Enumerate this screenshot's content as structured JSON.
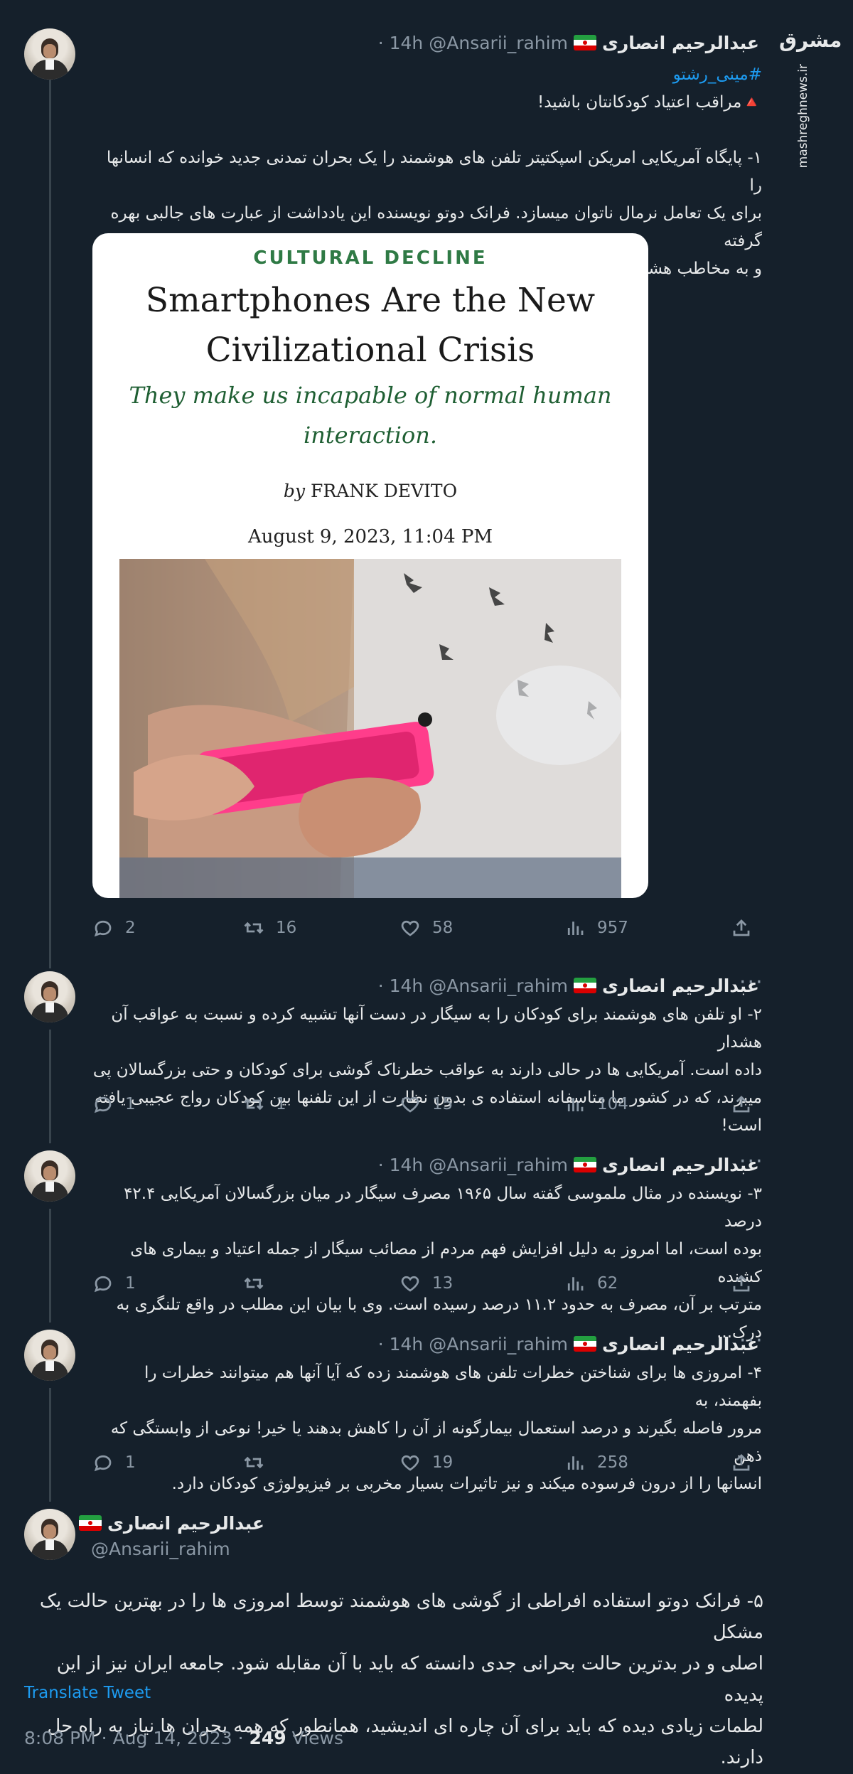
{
  "watermark": {
    "logo": "مشرق",
    "url": "mashreghnews.ir"
  },
  "author": {
    "name": "عبدالرحیم انصاری",
    "handle": "@Ansarii_rahim"
  },
  "tweets": [
    {
      "time": "· 14h",
      "hashtag": "#مینی_رشتو",
      "warning": "🔺مراقب اعتیاد کودکانتان باشید!",
      "text": "۱- پایگاه آمریکایی امریکن اسپکتیتر تلفن های هوشمند را یک بحران تمدنی جدید خوانده که انسانها را\nبرای یک تعامل نرمال ناتوان میسازد. فرانک دوتو نویسنده این یادداشت از عبارت های جالبی بهره گرفته\nو به مخاطب هشدارهای مهمی داده است.",
      "card": {
        "kicker": "CULTURAL DECLINE",
        "headline_1": "Smartphones Are the New",
        "headline_2": "Civilizational Crisis",
        "sub_1": "They make us incapable of normal human",
        "sub_2": "interaction.",
        "by": "by",
        "author": "FRANK DEVITO",
        "date": "August 9, 2023, 11:04 PM"
      },
      "stats": {
        "replies": "2",
        "retweets": "16",
        "likes": "58",
        "views": "957"
      }
    },
    {
      "time": "· 14h",
      "text": "۲- او تلفن های هوشمند برای کودکان را به سیگار در دست آنها تشبیه کرده و نسبت به عواقب آن هشدار\nداده است. آمریکایی ها در حالی دارند به عواقب خطرناک گوشی برای کودکان و حتی بزرگسالان پی\nمیبرند، که در کشور ما متاسفانه استفاده ی بدون نظارت از این تلفنها بین کودکان رواج عجیبی یافته است!",
      "stats": {
        "replies": "1",
        "retweets": "1",
        "likes": "15",
        "views": "104"
      }
    },
    {
      "time": "· 14h",
      "text": "۳- نویسنده در مثال ملموسی گفته سال ۱۹۶۵ مصرف سیگار در میان بزرگسالان آمریکایی ۴۲.۴ درصد\nبوده است، اما امروز به دلیل افزایش فهم مردم از مصائب سیگار از جمله اعتیاد و بیماری های کشنده\nمترتب بر آن، مصرف به حدود ۱۱.۲ درصد رسیده است. وی با بیان این مطلب در واقع تلنگری به درک...",
      "stats": {
        "replies": "1",
        "retweets": "",
        "likes": "13",
        "views": "62"
      }
    },
    {
      "time": "· 14h",
      "text": "۴- امروزی ها برای شناختن خطرات تلفن های هوشمند زده که آیا آنها هم میتوانند خطرات را بفهمند، به\nمرور فاصله بگیرند و درصد استعمال بیمارگونه از آن را کاهش بدهند یا خیر! نوعی از وابستگی که ذهن\nانسانها را از درون فرسوده میکند و نیز تاثیرات بسیار مخربی بر فیزیولوژی کودکان دارد.",
      "stats": {
        "replies": "1",
        "retweets": "",
        "likes": "19",
        "views": "258"
      }
    }
  ],
  "main_tweet": {
    "text": "۵- فرانک دوتو استفاده افراطی از گوشی های هوشمند توسط امروزی ها را در بهترین حالت یک مشکل\nاصلی و در بدترین حالت بحرانی جدی دانسته که باید با آن مقابله شود. جامعه ایران نیز از این پدیده\nلطمات زیادی دیده که باید برای آن چاره ای اندیشید، همانطور که همه بحران ها نیاز به راه حل دارند.",
    "translate": "Translate Tweet",
    "timestamp": "8:08 PM · Aug 14, 2023 · ",
    "views_count": "249",
    "views_label": " Views"
  },
  "icons": [
    "reply-icon",
    "retweet-icon",
    "like-icon",
    "views-icon",
    "share-icon",
    "more-icon"
  ]
}
